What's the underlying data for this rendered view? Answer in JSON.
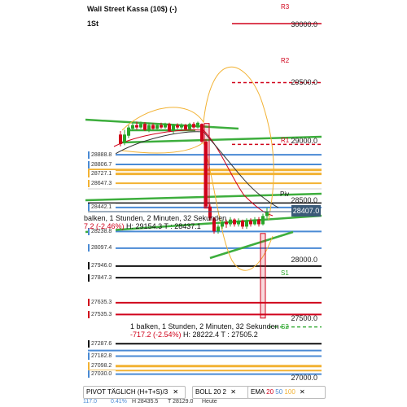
{
  "header": {
    "title": "Wall Street Kassa (10$) (-)",
    "timeframe": "1St"
  },
  "price_axis": [
    "30000.0",
    "29500.0",
    "29000.0",
    "28500.0",
    "28000.0",
    "27500.0",
    "27000.0"
  ],
  "current_price": "28407.0",
  "pivot_labels": {
    "r3": "R3",
    "r2": "R2",
    "r1": "R1",
    "piv": "Piv",
    "s1": "S1",
    "s2": "S2"
  },
  "level_boxes": [
    {
      "label": "28888.8",
      "color": "#4a8ad4"
    },
    {
      "label": "28806.7",
      "color": "#4a8ad4"
    },
    {
      "label": "28727.1",
      "color": "#f2b233"
    },
    {
      "label": "28647.3",
      "color": "#f2b233"
    },
    {
      "label": "28442.1",
      "color": "#4a8ad4"
    },
    {
      "label": "28238.8",
      "color": "#4a8ad4"
    },
    {
      "label": "28097.4",
      "color": "#4a8ad4"
    },
    {
      "label": "27946.0",
      "color": "#111111"
    },
    {
      "label": "27847.3",
      "color": "#111111"
    },
    {
      "label": "27635.3",
      "color": "#d0021b"
    },
    {
      "label": "27535.3",
      "color": "#d0021b"
    },
    {
      "label": "27287.6",
      "color": "#111111"
    },
    {
      "label": "27182.8",
      "color": "#4a8ad4"
    },
    {
      "label": "27098.2",
      "color": "#f2b233"
    },
    {
      "label": "27030.0",
      "color": "#4a8ad4"
    }
  ],
  "info_upper": {
    "line1": "balken, 1 Stunden, 2 Minuten, 32 Sekunden",
    "line2_change": "7.2 (-2.46%)",
    "line2_rest": "H: 29154.3 T : 28437.1"
  },
  "info_lower": {
    "line1": "1 balken, 1 Stunden, 2 Minuten, 32 Sekunden",
    "line2_change": "-717.2 (-2.54%)",
    "line2_rest": "H: 28222.4 T : 27505.2"
  },
  "indicators": {
    "pivot": "PIVOT",
    "pivot_period": "TÄGLICH",
    "pivot_params": "(H+T+S)/3",
    "boll": "BOLL",
    "boll_p1": "20",
    "boll_p2": "2",
    "ema": "EMA",
    "ema_p1": "20",
    "ema_p2": "50",
    "ema_p3": "100"
  },
  "stats": {
    "a": "117.0",
    "b": "0.41%",
    "h": "H 28435.5",
    "t": "T 28129.0",
    "heute": "Heute"
  },
  "colors": {
    "up": "#2aa52a",
    "down": "#d0021b",
    "pivot_line": "#3dae3d",
    "boll": "#f2b233",
    "ema1": "#d0021b",
    "ema2": "#4a8ad4",
    "ema3": "#f2b233"
  }
}
